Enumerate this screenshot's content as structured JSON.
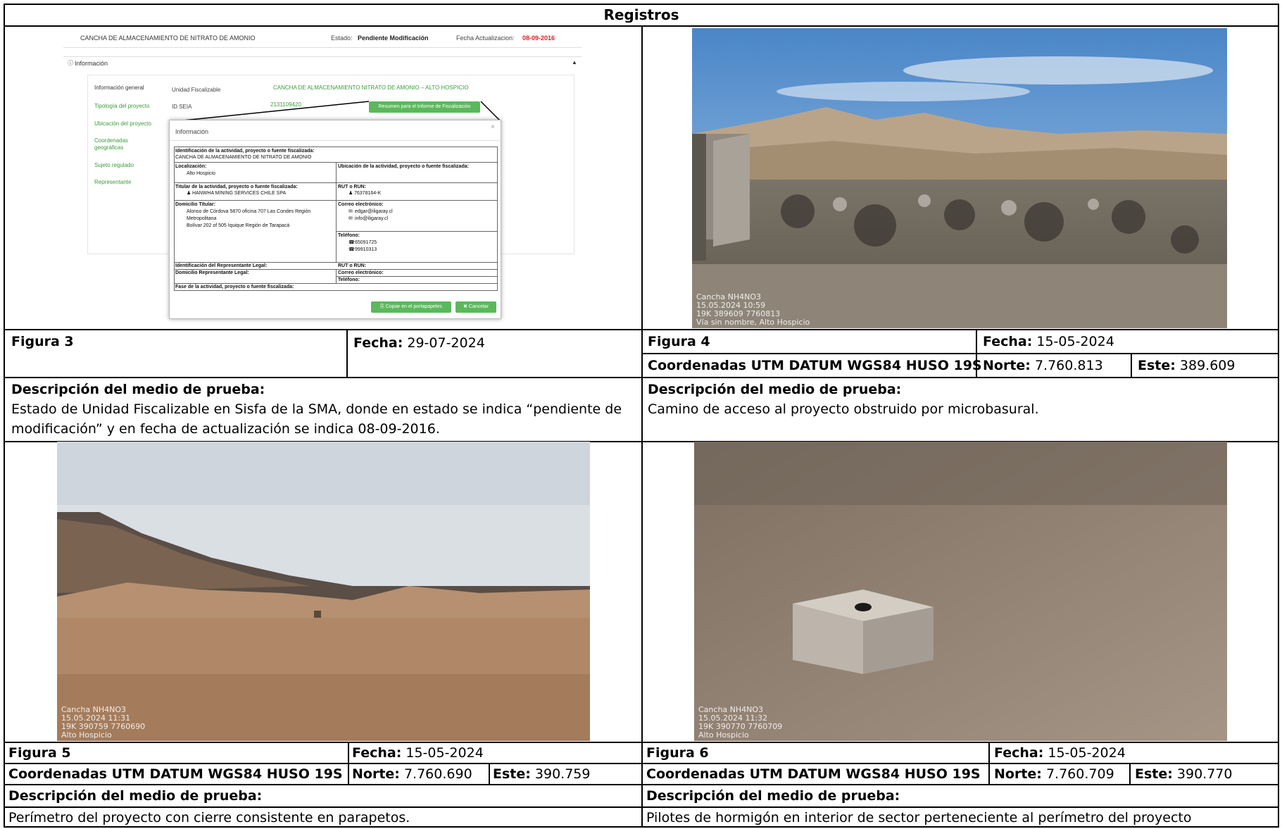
{
  "header": {
    "title": "Registros"
  },
  "screenshot": {
    "project_name": "CANCHA DE ALMACENAMIENTO DE NITRATO DE AMONIO",
    "estado_label": "Estado:",
    "estado_value": "Pendiente Modificación",
    "fecha_label": "Fecha Actualizacion:",
    "fecha_value": "08-09-2016",
    "info_title": "Información",
    "side_menu": [
      "Información general",
      "Tipología del proyecto",
      "Ubicación del proyecto",
      "Coordenadas geográficas",
      "Sujeto regulado",
      "Representante"
    ],
    "unidad_label": "Unidad Fiscalizable",
    "unidad_value": "CANCHA DE ALMACENAMIENTO NITRATO DE AMONIO – ALTO HOSPICIO",
    "idseia_label": "ID SEIA",
    "idseia_value": "2131109420",
    "resumen_button": "Resumen para el Informe de Fiscalización",
    "modal": {
      "title": "Información",
      "close": "×",
      "ident_label": "Identificación de la actividad, proyecto o fuente fiscalizada:",
      "ident_value": "CANCHA DE ALMACENAMIENTO DE NITRATO DE AMONIO",
      "loc_label": "Localización:",
      "loc_value": "Alto Hospicio",
      "ubic_label": "Ubicación de la actividad, proyecto o fuente fiscalizada:",
      "titular_label": "Titular de la actividad, proyecto o fuente fiscalizada:",
      "titular_value": "HANWHA MINING SERVICES CHILE SPA",
      "rut_label": "RUT o RUN:",
      "rut_value": "76378164-K",
      "dom_label": "Domicilio Titular:",
      "dom_line1": "Alonso de Córdova 5870 oficina 707 Las Condes Región",
      "dom_line2": "Metropolitana",
      "dom_line3": "Bolívar 202 of 505 Iquique Región de Tarapacá",
      "correo_label": "Correo electrónico:",
      "correo1": "edgar@iligaray.cl",
      "correo2": "info@iligaray.cl",
      "tel_label": "Teléfono:",
      "tel1": "65091725",
      "tel2": "99910313",
      "rep_label": "Identificación del Representante Legal:",
      "rep_rut_label": "RUT o RUN:",
      "rep_dom_label": "Domicilio Representante Legal:",
      "rep_correo_label": "Correo electrónico:",
      "rep_tel_label": "Teléfono:",
      "fase_label": "Fase de la actividad, proyecto o fuente fiscalizada:",
      "copy_button": "Copiar en el portapapeles",
      "cancel_button": "Cancelar"
    }
  },
  "photo_stamps": {
    "fig4": "Cancha NH4NO3\n15.05.2024 10:59\n19K 389609 7760813\nVía sin nombre, Alto Hospicio",
    "fig5": "Cancha NH4NO3\n15.05.2024 11:31\n19K 390759 7760690\nAlto Hospicio",
    "fig6": "Cancha NH4NO3\n15.05.2024 11:32\n19K 390770 7760709\nAlto Hospicio"
  },
  "labels": {
    "fecha": "Fecha:",
    "coords": "Coordenadas UTM DATUM WGS84 HUSO 19S",
    "norte": "Norte:",
    "este": "Este:",
    "desc": "Descripción del medio de prueba:"
  },
  "figures": {
    "fig3": {
      "name": "Figura 3",
      "fecha": "29-07-2024",
      "desc_line1": "Estado de Unidad Fiscalizable en Sisfa de la SMA, donde en estado se indica “pendiente de",
      "desc_line2": "modificación” y en fecha de actualización se indica 08-09-2016."
    },
    "fig4": {
      "name": "Figura 4",
      "fecha": "15-05-2024",
      "norte": "7.760.813",
      "este": "389.609",
      "desc": "Camino de acceso al proyecto obstruido por microbasural."
    },
    "fig5": {
      "name": "Figura 5",
      "fecha": "15-05-2024",
      "norte": "7.760.690",
      "este": "390.759",
      "desc": "Perímetro del proyecto con cierre consistente en parapetos."
    },
    "fig6": {
      "name": "Figura 6",
      "fecha": "15-05-2024",
      "norte": "7.760.709",
      "este": "390.770",
      "desc": "Pilotes de hormigón en interior de sector perteneciente al perímetro del proyecto"
    }
  }
}
